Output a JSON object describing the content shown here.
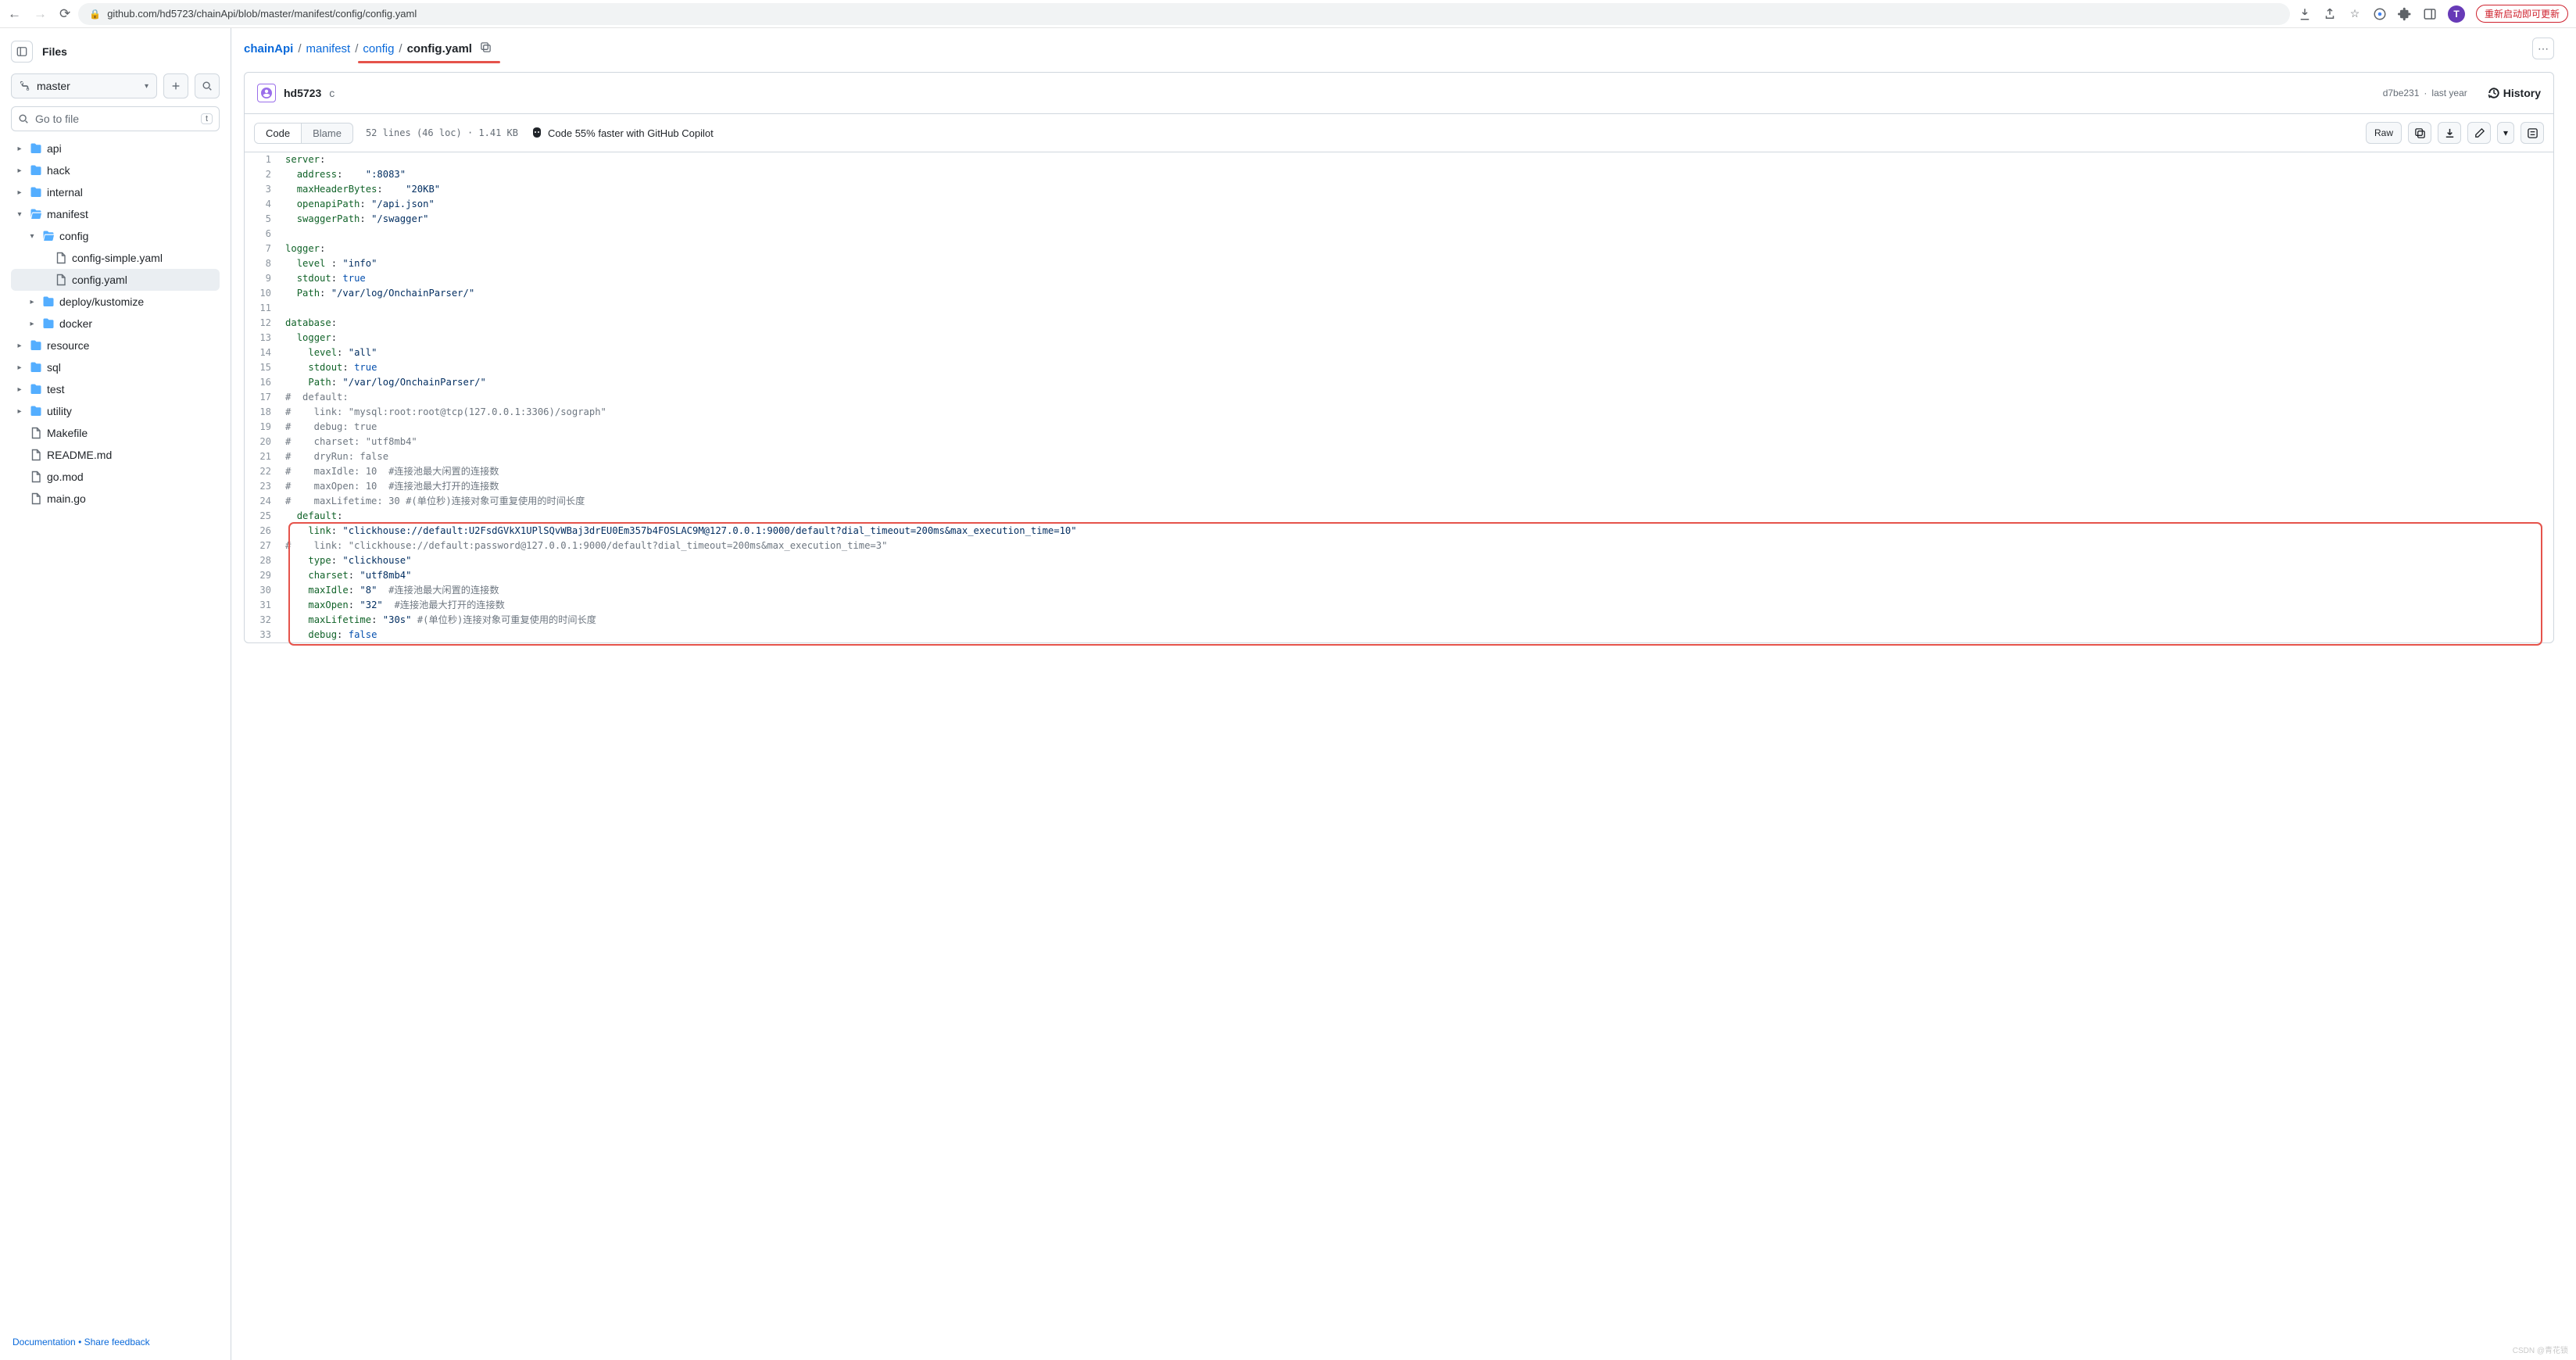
{
  "browser": {
    "url": "github.com/hd5723/chainApi/blob/master/manifest/config/config.yaml",
    "avatar_letter": "T",
    "update_label": "重新启动即可更新"
  },
  "sidebar": {
    "title": "Files",
    "branch": "master",
    "gotofile_placeholder": "Go to file",
    "gotofile_key": "t",
    "doc_link": "Documentation",
    "feedback_link": "Share feedback",
    "tree": [
      {
        "depth": 0,
        "kind": "folder",
        "open": false,
        "label": "api"
      },
      {
        "depth": 0,
        "kind": "folder",
        "open": false,
        "label": "hack"
      },
      {
        "depth": 0,
        "kind": "folder",
        "open": false,
        "label": "internal"
      },
      {
        "depth": 0,
        "kind": "folder",
        "open": true,
        "label": "manifest"
      },
      {
        "depth": 1,
        "kind": "folder",
        "open": true,
        "label": "config"
      },
      {
        "depth": 2,
        "kind": "file",
        "label": "config-simple.yaml"
      },
      {
        "depth": 2,
        "kind": "file",
        "label": "config.yaml",
        "selected": true
      },
      {
        "depth": 1,
        "kind": "folder",
        "open": false,
        "label": "deploy/kustomize"
      },
      {
        "depth": 1,
        "kind": "folder",
        "open": false,
        "label": "docker"
      },
      {
        "depth": 0,
        "kind": "folder",
        "open": false,
        "label": "resource"
      },
      {
        "depth": 0,
        "kind": "folder",
        "open": false,
        "label": "sql"
      },
      {
        "depth": 0,
        "kind": "folder",
        "open": false,
        "label": "test"
      },
      {
        "depth": 0,
        "kind": "folder",
        "open": false,
        "label": "utility"
      },
      {
        "depth": 0,
        "kind": "file",
        "label": "Makefile"
      },
      {
        "depth": 0,
        "kind": "file",
        "label": "README.md"
      },
      {
        "depth": 0,
        "kind": "file",
        "label": "go.mod"
      },
      {
        "depth": 0,
        "kind": "file",
        "label": "main.go"
      }
    ]
  },
  "crumbs": {
    "parts": [
      {
        "label": "chainApi",
        "link": true,
        "bold": true
      },
      {
        "label": "manifest",
        "link": true
      },
      {
        "label": "config",
        "link": true
      },
      {
        "label": "config.yaml",
        "link": false,
        "current": true
      }
    ]
  },
  "commit": {
    "author": "hd5723",
    "message": "c",
    "sha": "d7be231",
    "age": "last year",
    "history_label": "History"
  },
  "toolbar": {
    "code": "Code",
    "blame": "Blame",
    "lines": "52 lines (46 loc) · 1.41 KB",
    "copilot": "Code 55% faster with GitHub Copilot",
    "raw": "Raw"
  },
  "code_lines": [
    {
      "n": 1,
      "h": "<span class='k'>server</span>:"
    },
    {
      "n": 2,
      "h": "  <span class='k'>address</span>:    <span class='s'>\":8083\"</span>"
    },
    {
      "n": 3,
      "h": "  <span class='k'>maxHeaderBytes</span>:    <span class='s'>\"20KB\"</span>"
    },
    {
      "n": 4,
      "h": "  <span class='k'>openapiPath</span>: <span class='s'>\"/api.json\"</span>"
    },
    {
      "n": 5,
      "h": "  <span class='k'>swaggerPath</span>: <span class='s'>\"/swagger\"</span>"
    },
    {
      "n": 6,
      "h": ""
    },
    {
      "n": 7,
      "h": "<span class='k'>logger</span>:"
    },
    {
      "n": 8,
      "h": "  <span class='k'>level </span>: <span class='s'>\"info\"</span>"
    },
    {
      "n": 9,
      "h": "  <span class='k'>stdout</span>: <span class='b'>true</span>"
    },
    {
      "n": 10,
      "h": "  <span class='k'>Path</span>: <span class='s'>\"/var/log/OnchainParser/\"</span>"
    },
    {
      "n": 11,
      "h": ""
    },
    {
      "n": 12,
      "h": "<span class='k'>database</span>:"
    },
    {
      "n": 13,
      "h": "  <span class='k'>logger</span>:"
    },
    {
      "n": 14,
      "h": "    <span class='k'>level</span>: <span class='s'>\"all\"</span>"
    },
    {
      "n": 15,
      "h": "    <span class='k'>stdout</span>: <span class='b'>true</span>"
    },
    {
      "n": 16,
      "h": "    <span class='k'>Path</span>: <span class='s'>\"/var/log/OnchainParser/\"</span>"
    },
    {
      "n": 17,
      "h": "<span class='c'>#  default:</span>"
    },
    {
      "n": 18,
      "h": "<span class='c'>#    link: \"mysql:root:root@tcp(127.0.0.1:3306)/sograph\"</span>"
    },
    {
      "n": 19,
      "h": "<span class='c'>#    debug: true</span>"
    },
    {
      "n": 20,
      "h": "<span class='c'>#    charset: \"utf8mb4\"</span>"
    },
    {
      "n": 21,
      "h": "<span class='c'>#    dryRun: false</span>"
    },
    {
      "n": 22,
      "h": "<span class='c'>#    maxIdle: 10  #连接池最大闲置的连接数</span>"
    },
    {
      "n": 23,
      "h": "<span class='c'>#    maxOpen: 10  #连接池最大打开的连接数</span>"
    },
    {
      "n": 24,
      "h": "<span class='c'>#    maxLifetime: 30 #(单位秒)连接对象可重复使用的时间长度</span>"
    },
    {
      "n": 25,
      "h": "  <span class='k'>default</span>:"
    },
    {
      "n": 26,
      "h": "    <span class='k'>link</span>: <span class='s'>\"clickhouse://default:U2FsdGVkX1UPlSQvWBaj3drEU0Em357b4FOSLAC9M@127.0.0.1:9000/default?dial_timeout=200ms&amp;max_execution_time=10\"</span>"
    },
    {
      "n": 27,
      "h": "<span class='c'>#    link: \"clickhouse://default:password@127.0.0.1:9000/default?dial_timeout=200ms&amp;max_execution_time=3\"</span>"
    },
    {
      "n": 28,
      "h": "    <span class='k'>type</span>: <span class='s'>\"clickhouse\"</span>"
    },
    {
      "n": 29,
      "h": "    <span class='k'>charset</span>: <span class='s'>\"utf8mb4\"</span>"
    },
    {
      "n": 30,
      "h": "    <span class='k'>maxIdle</span>: <span class='s'>\"8\"</span>  <span class='c'>#连接池最大闲置的连接数</span>"
    },
    {
      "n": 31,
      "h": "    <span class='k'>maxOpen</span>: <span class='s'>\"32\"</span>  <span class='c'>#连接池最大打开的连接数</span>"
    },
    {
      "n": 32,
      "h": "    <span class='k'>maxLifetime</span>: <span class='s'>\"30s\"</span> <span class='c'>#(单位秒)连接对象可重复使用的时间长度</span>"
    },
    {
      "n": 33,
      "h": "    <span class='k'>debug</span>: <span class='b'>false</span>"
    }
  ],
  "watermark": "CSDN @青花锁"
}
